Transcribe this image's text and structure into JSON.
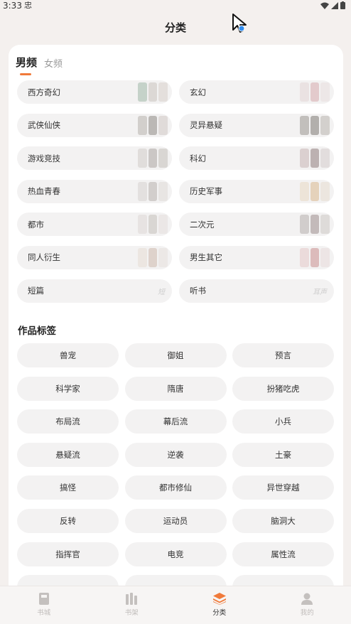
{
  "status": {
    "time": "3:33",
    "app_glyph": "忠"
  },
  "header": {
    "title": "分类"
  },
  "gender_tabs": [
    {
      "label": "男频",
      "active": true
    },
    {
      "label": "女频",
      "active": false
    }
  ],
  "categories": [
    {
      "label": "西方奇幻"
    },
    {
      "label": "玄幻"
    },
    {
      "label": "武侠仙侠"
    },
    {
      "label": "灵异悬疑"
    },
    {
      "label": "游戏竞技"
    },
    {
      "label": "科幻"
    },
    {
      "label": "热血青春"
    },
    {
      "label": "历史军事"
    },
    {
      "label": "都市"
    },
    {
      "label": "二次元"
    },
    {
      "label": "同人衍生"
    },
    {
      "label": "男生其它"
    },
    {
      "label": "短篇",
      "thumb_text": "短"
    },
    {
      "label": "听书",
      "thumb_text": "耳声"
    }
  ],
  "tags_section": {
    "title": "作品标签"
  },
  "tags": [
    "兽宠",
    "御姐",
    "预言",
    "科学家",
    "隋唐",
    "扮猪吃虎",
    "布局流",
    "幕后流",
    "小兵",
    "悬疑流",
    "逆袭",
    "土豪",
    "搞怪",
    "都市修仙",
    "异世穿越",
    "反转",
    "运动员",
    "脑洞大",
    "指挥官",
    "电竞",
    "属性流"
  ],
  "bottom_nav": [
    {
      "label": "书城",
      "icon": "book-icon",
      "active": false
    },
    {
      "label": "书架",
      "icon": "bookshelf-icon",
      "active": false
    },
    {
      "label": "分类",
      "icon": "layers-icon",
      "active": true
    },
    {
      "label": "我的",
      "icon": "person-icon",
      "active": false
    }
  ],
  "colors": {
    "accent": "#f07a3a",
    "background": "#f4f0ee",
    "pill": "#f3f2f2"
  }
}
